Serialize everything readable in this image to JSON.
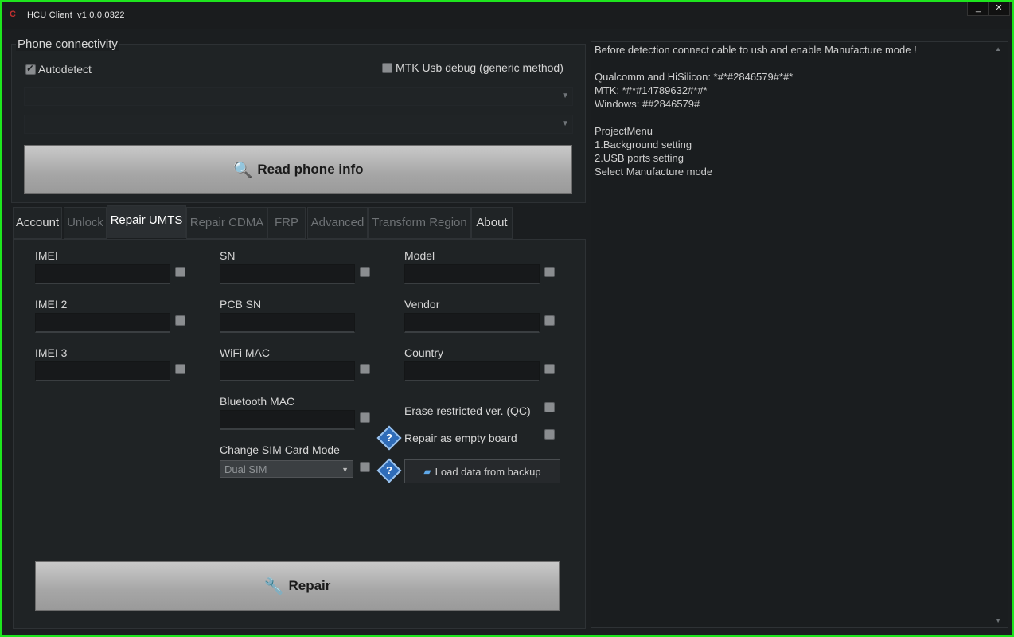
{
  "window": {
    "title": "HCU Client",
    "version": "v1.0.0.0322",
    "min_glyph": "_",
    "close_glyph": "✕"
  },
  "connectivity": {
    "group_title": "Phone connectivity",
    "autodetect_label": "Autodetect",
    "autodetect_checked": true,
    "mtk_label": "MTK Usb debug (generic method)",
    "mtk_checked": false,
    "read_button": "Read phone info"
  },
  "tabs": [
    {
      "label": "Account",
      "enabled": true
    },
    {
      "label": "Unlock",
      "enabled": false
    },
    {
      "label": "Repair UMTS",
      "enabled": true,
      "active": true
    },
    {
      "label": "Repair CDMA",
      "enabled": false
    },
    {
      "label": "FRP",
      "enabled": false
    },
    {
      "label": "Advanced",
      "enabled": false
    },
    {
      "label": "Transform Region",
      "enabled": false
    },
    {
      "label": "About",
      "enabled": true
    }
  ],
  "repair": {
    "imei": "IMEI",
    "imei2": "IMEI 2",
    "imei3": "IMEI 3",
    "sn": "SN",
    "pcb_sn": "PCB SN",
    "wifi_mac": "WiFi MAC",
    "bt_mac": "Bluetooth MAC",
    "sim_mode_label": "Change SIM Card Mode",
    "sim_mode_value": "Dual SIM",
    "model": "Model",
    "vendor": "Vendor",
    "country": "Country",
    "erase_restricted": "Erase restricted ver. (QC)",
    "repair_empty": "Repair as empty board",
    "load_backup": "Load data from backup",
    "repair_button": "Repair"
  },
  "log": [
    "Before detection connect cable to usb and enable Manufacture mode !",
    "",
    "Qualcomm and HiSilicon: *#*#2846579#*#*",
    "MTK: *#*#14789632#*#*",
    "Windows: ##2846579#",
    "",
    "ProjectMenu",
    "1.Background setting",
    "2.USB ports setting",
    "Select Manufacture mode"
  ]
}
